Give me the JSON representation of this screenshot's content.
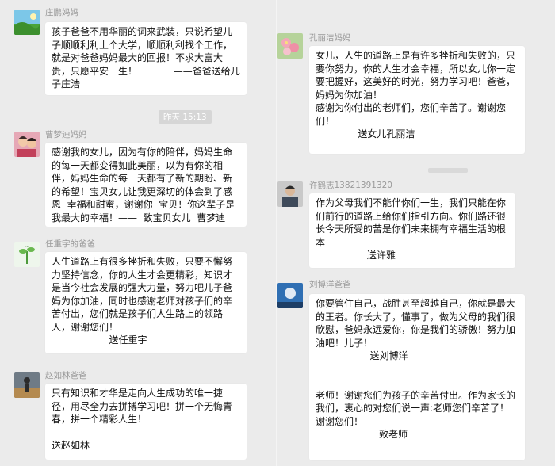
{
  "left_column": {
    "messages": [
      {
        "sender": "庄鹏妈妈",
        "text": "孩子爸爸不用华丽的词来武装，只说希望儿子顺顺利利上个大学，顺顺利利找个工作，就是对爸爸妈妈最大的回报！不求大富大贵，只愿平安一生！            ——爸爸送给儿子庄浩"
      },
      {
        "sender": "曹梦迪妈妈",
        "text": "感谢我的女儿，因为有你的陪伴，妈妈生命的每一天都变得如此美丽，以为有你的相伴，妈妈生命的每一天都有了新的期盼、新的希望！宝贝女儿让我更深切的体会到了感恩  幸福和甜蜜，谢谢你  宝贝！你这辈子是我最大的幸福！——  致宝贝女儿  曹梦迪"
      },
      {
        "sender": "任重宇的爸爸",
        "text": "人生道路上有很多挫折和失败，只要不懈努力坚持信念，你的人生才会更精彩，知识才是当今社会发展的强大力量，努力吧儿子爸妈为你加油，同时也感谢老师对孩子们的辛苦付出，您们就是孩子们人生路上的领路人，谢谢您们！\n                   送任重宇"
      },
      {
        "sender": "赵如林爸爸",
        "text": "只有知识和才华是走向人生成功的唯一捷径，用尽全力去拼搏学习吧！拼一个无悔青春，拼一个精彩人生！\n\n送赵如林"
      }
    ],
    "timestamp": "昨天 15:13"
  },
  "right_column": {
    "messages": [
      {
        "sender": "孔丽洁妈妈",
        "text": "女儿，人生的道路上是有许多挫折和失败的，只要你努力，你的人生才会幸福，所以女儿你一定要把握好，这美好的时光，努力学习吧！爸爸，妈妈为你加油！\n感谢为你付出的老师们，您们辛苦了。谢谢您们！\n              送女儿孔丽洁"
      },
      {
        "sender": "许鹤志13821391320",
        "text": "作为父母我们不能伴你们一生，我们只能在你们前行的道路上给你们指引方向。你们路还很长今天所受的苦是你们未来拥有幸福生活的根本\n                 送许雅"
      },
      {
        "sender": "刘博洋爸爸",
        "text": "你要管住自己，战胜甚至超越自己，你就是最大的王者。你长大了，懂事了，做为父母的我们很欣慰，爸妈永远爱你，你是我们的骄傲！努力加油吧！儿子！\n                  送刘博洋\n\n\n老师！谢谢您们为孩子的辛苦付出。作为家长的我们，衷心的对您们说一声:老师您们辛苦了！谢谢您们！\n                     致老师"
      }
    ]
  },
  "colors": {
    "background": "#ebebeb",
    "bubble": "#ffffff",
    "name_text": "#9a9a9a",
    "timestamp_bg": "#d6d6d6"
  }
}
